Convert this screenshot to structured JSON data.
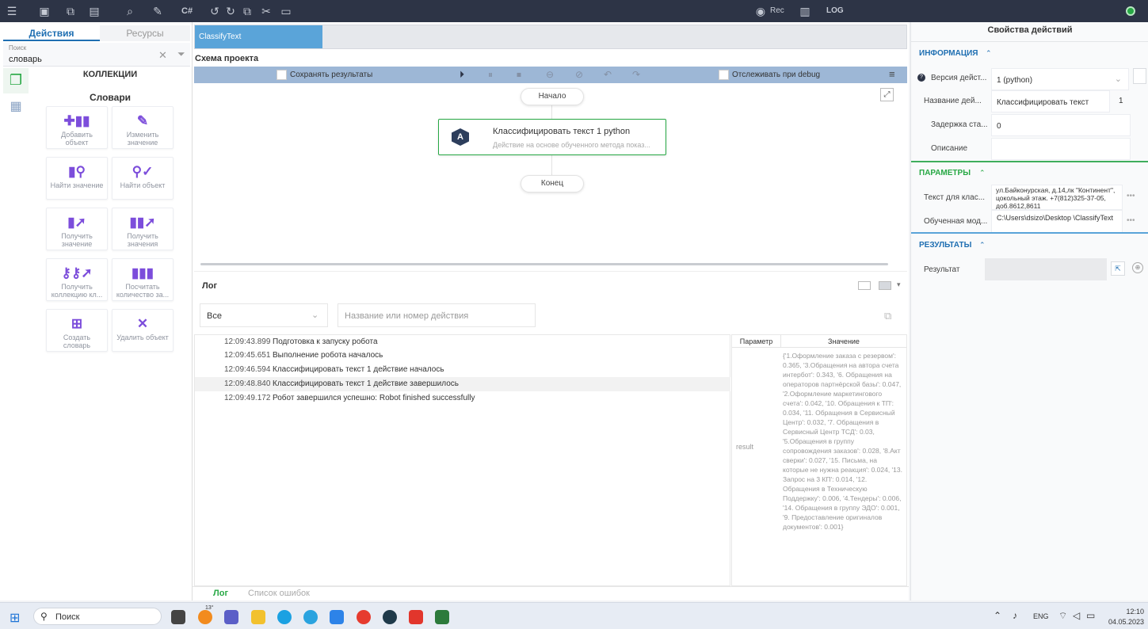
{
  "toolbar": {
    "rec_label": "Rec",
    "log_label": "LOG",
    "csharp_label": "C#"
  },
  "left": {
    "tab_actions": "Действия",
    "tab_resources": "Ресурсы",
    "search_label": "Поиск",
    "search_value": "словарь",
    "collections_title": "КОЛЛЕКЦИИ",
    "dictionaries_title": "Словари",
    "tiles": [
      {
        "l1": "Добавить",
        "l2": "объект"
      },
      {
        "l1": "Изменить",
        "l2": "значение"
      },
      {
        "l1": "Найти значение",
        "l2": ""
      },
      {
        "l1": "Найти объект",
        "l2": ""
      },
      {
        "l1": "Получить",
        "l2": "значение"
      },
      {
        "l1": "Получить",
        "l2": "значения"
      },
      {
        "l1": "Получить",
        "l2": "коллекцию кл..."
      },
      {
        "l1": "Посчитать",
        "l2": "количество за..."
      },
      {
        "l1": "Создать",
        "l2": "словарь"
      },
      {
        "l1": "Удалить объект",
        "l2": ""
      }
    ]
  },
  "center": {
    "tab": "ClassifyText",
    "schema_title": "Схема проекта",
    "save_results": "Сохранять результаты",
    "track_debug": "Отслеживать при debug",
    "start_node": "Начало",
    "end_node": "Конец",
    "action_title": "Классифицировать текст  1  python",
    "action_desc": "Действие на основе обученного метода показ...",
    "action_icon": "A",
    "log_title": "Лог",
    "filter_value": "Все",
    "filter_placeholder": "Название или номер действия",
    "log_rows": [
      {
        "time": "12:09:43.899",
        "msg": "Подготовка к запуску робота"
      },
      {
        "time": "12:09:45.651",
        "msg": "Выполнение робота началось"
      },
      {
        "time": "12:09:46.594",
        "msg": "Классифицировать текст 1 действие началось"
      },
      {
        "time": "12:09:48.840",
        "msg": "Классифицировать текст 1 действие завершилось"
      },
      {
        "time": "12:09:49.172",
        "msg": "Робот завершился успешно: Robot finished successfully"
      }
    ],
    "param_header": "Параметр",
    "value_header": "Значение",
    "param_name": "result",
    "param_value": "{'1.Оформление заказа с резервом': 0.365, '3.Обращения на автора счета интербот': 0.343, '6. Обращения на операторов партнёрской базы': 0.047, '2.Оформление маркетингового счета': 0.042, '10. Обращения к ТП': 0.034, '11. Обращения в Сервисный Центр': 0.032, '7. Обращения в Сервисный Центр ТСД': 0.03, '5.Обращения в группу сопровождения заказов': 0.028, '8.Акт сверки': 0.027, '15. Письма, на которые не нужна реакция': 0.024, '13. Запрос на 3 КП': 0.014, '12. Обращения в Техническую Поддержку': 0.006, '4.Тендеры': 0.006, '14. Обращения в группу ЭДО': 0.001, '9. Предоставление оригиналов документов': 0.001}",
    "bottom_tab_log": "Лог",
    "bottom_tab_errors": "Список ошибок"
  },
  "right": {
    "title": "Свойства действий",
    "info_section": "ИНФОРМАЦИЯ",
    "params_section": "ПАРАМЕТРЫ",
    "results_section": "РЕЗУЛЬТАТЫ",
    "version_label": "Версия дейст...",
    "version_value": "1 (python)",
    "name_label": "Название дей...",
    "name_value": "Классифицировать текст",
    "name_number": "1",
    "delay_label": "Задержка ста...",
    "delay_value": "0",
    "desc_label": "Описание",
    "desc_value": "",
    "text_label": "Текст для клас...",
    "text_value": "ул.Байконурская, д.14,лк \"Континент\", цокольный этаж. +7(812)325-37-05, доб.8612,8611",
    "model_label": "Обученная мод...",
    "model_value": "C:\\Users\\dsizo\\Desktop \\ClassifyText",
    "result_label": "Результат",
    "result_value": ""
  },
  "taskbar": {
    "search": "Поиск",
    "lang": "ENG",
    "time": "12:10",
    "date": "04.05.2023",
    "temp": "13°"
  },
  "colors": {
    "toolbar_bg": "#2d3446",
    "accent_blue": "#1f6fb2",
    "accent_purple": "#7c4ddb",
    "accent_green": "#27a844"
  }
}
